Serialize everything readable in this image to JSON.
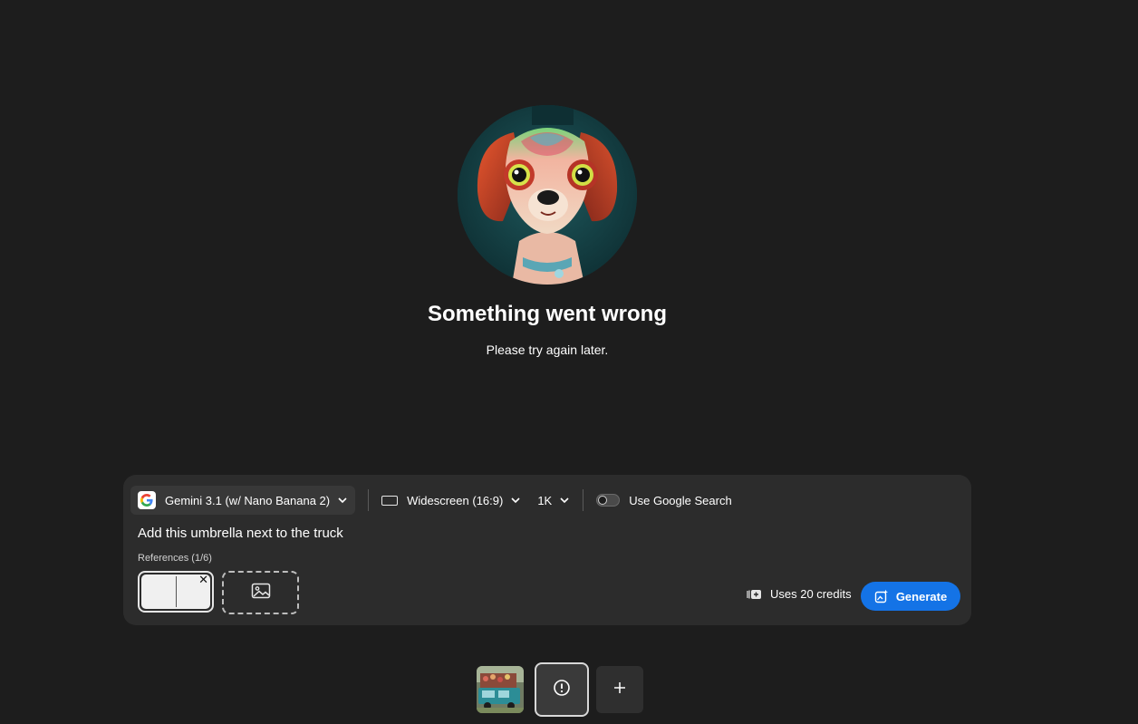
{
  "error": {
    "title": "Something went wrong",
    "message": "Please try again later."
  },
  "toolbar": {
    "model_label": "Gemini 3.1 (w/ Nano Banana 2)",
    "model_icon": "google-g-icon",
    "aspect_label": "Widescreen (16:9)",
    "resolution_label": "1K",
    "google_search_label": "Use Google Search",
    "google_search_enabled": false
  },
  "prompt": {
    "text": "Add this umbrella next to the truck"
  },
  "references": {
    "label": "References (1/6)"
  },
  "footer": {
    "credits_label": "Uses 20 credits",
    "generate_label": "Generate"
  },
  "colors": {
    "background": "#1d1d1d",
    "panel": "#2c2c2c",
    "accent": "#1473e6"
  }
}
